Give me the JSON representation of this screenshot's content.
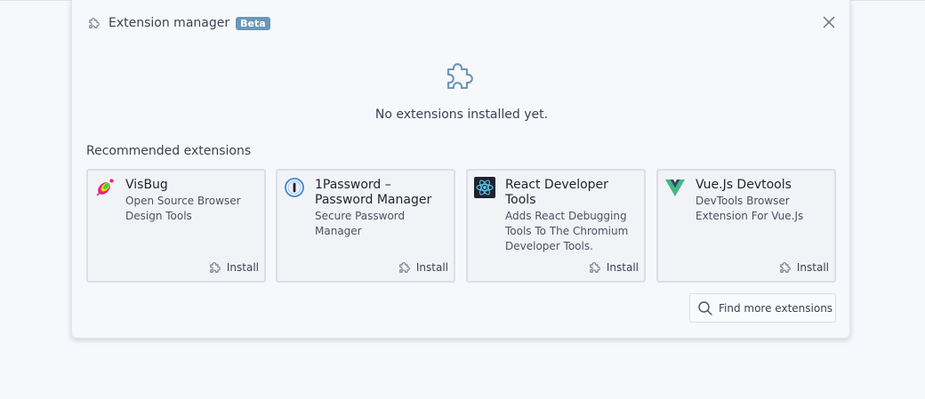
{
  "header": {
    "title": "Extension manager",
    "badge": "Beta",
    "icon": "puzzle-icon",
    "close_icon": "close-icon"
  },
  "empty_state": {
    "icon": "puzzle-icon",
    "text": "No extensions installed yet."
  },
  "recommended": {
    "title": "Recommended extensions",
    "items": [
      {
        "name": "VisBug",
        "description": "Open Source Browser Design Tools",
        "install_label": "Install",
        "icon": "visbug-logo-icon"
      },
      {
        "name": "1Password – Password Manager",
        "description": "Secure Password Manager",
        "install_label": "Install",
        "icon": "1password-logo-icon"
      },
      {
        "name": "React Developer Tools",
        "description": "Adds React Debugging Tools To The Chromium Developer Tools.",
        "install_label": "Install",
        "icon": "react-logo-icon"
      },
      {
        "name": "Vue.Js Devtools",
        "description": "DevTools Browser Extension For Vue.Js",
        "install_label": "Install",
        "icon": "vue-logo-icon"
      }
    ]
  },
  "find_more": {
    "label": "Find more extensions",
    "icon": "search-icon"
  },
  "colors": {
    "badge": "#6b98b6",
    "empty_icon": "#6b98b6",
    "page_background": "#f6f8fc"
  }
}
